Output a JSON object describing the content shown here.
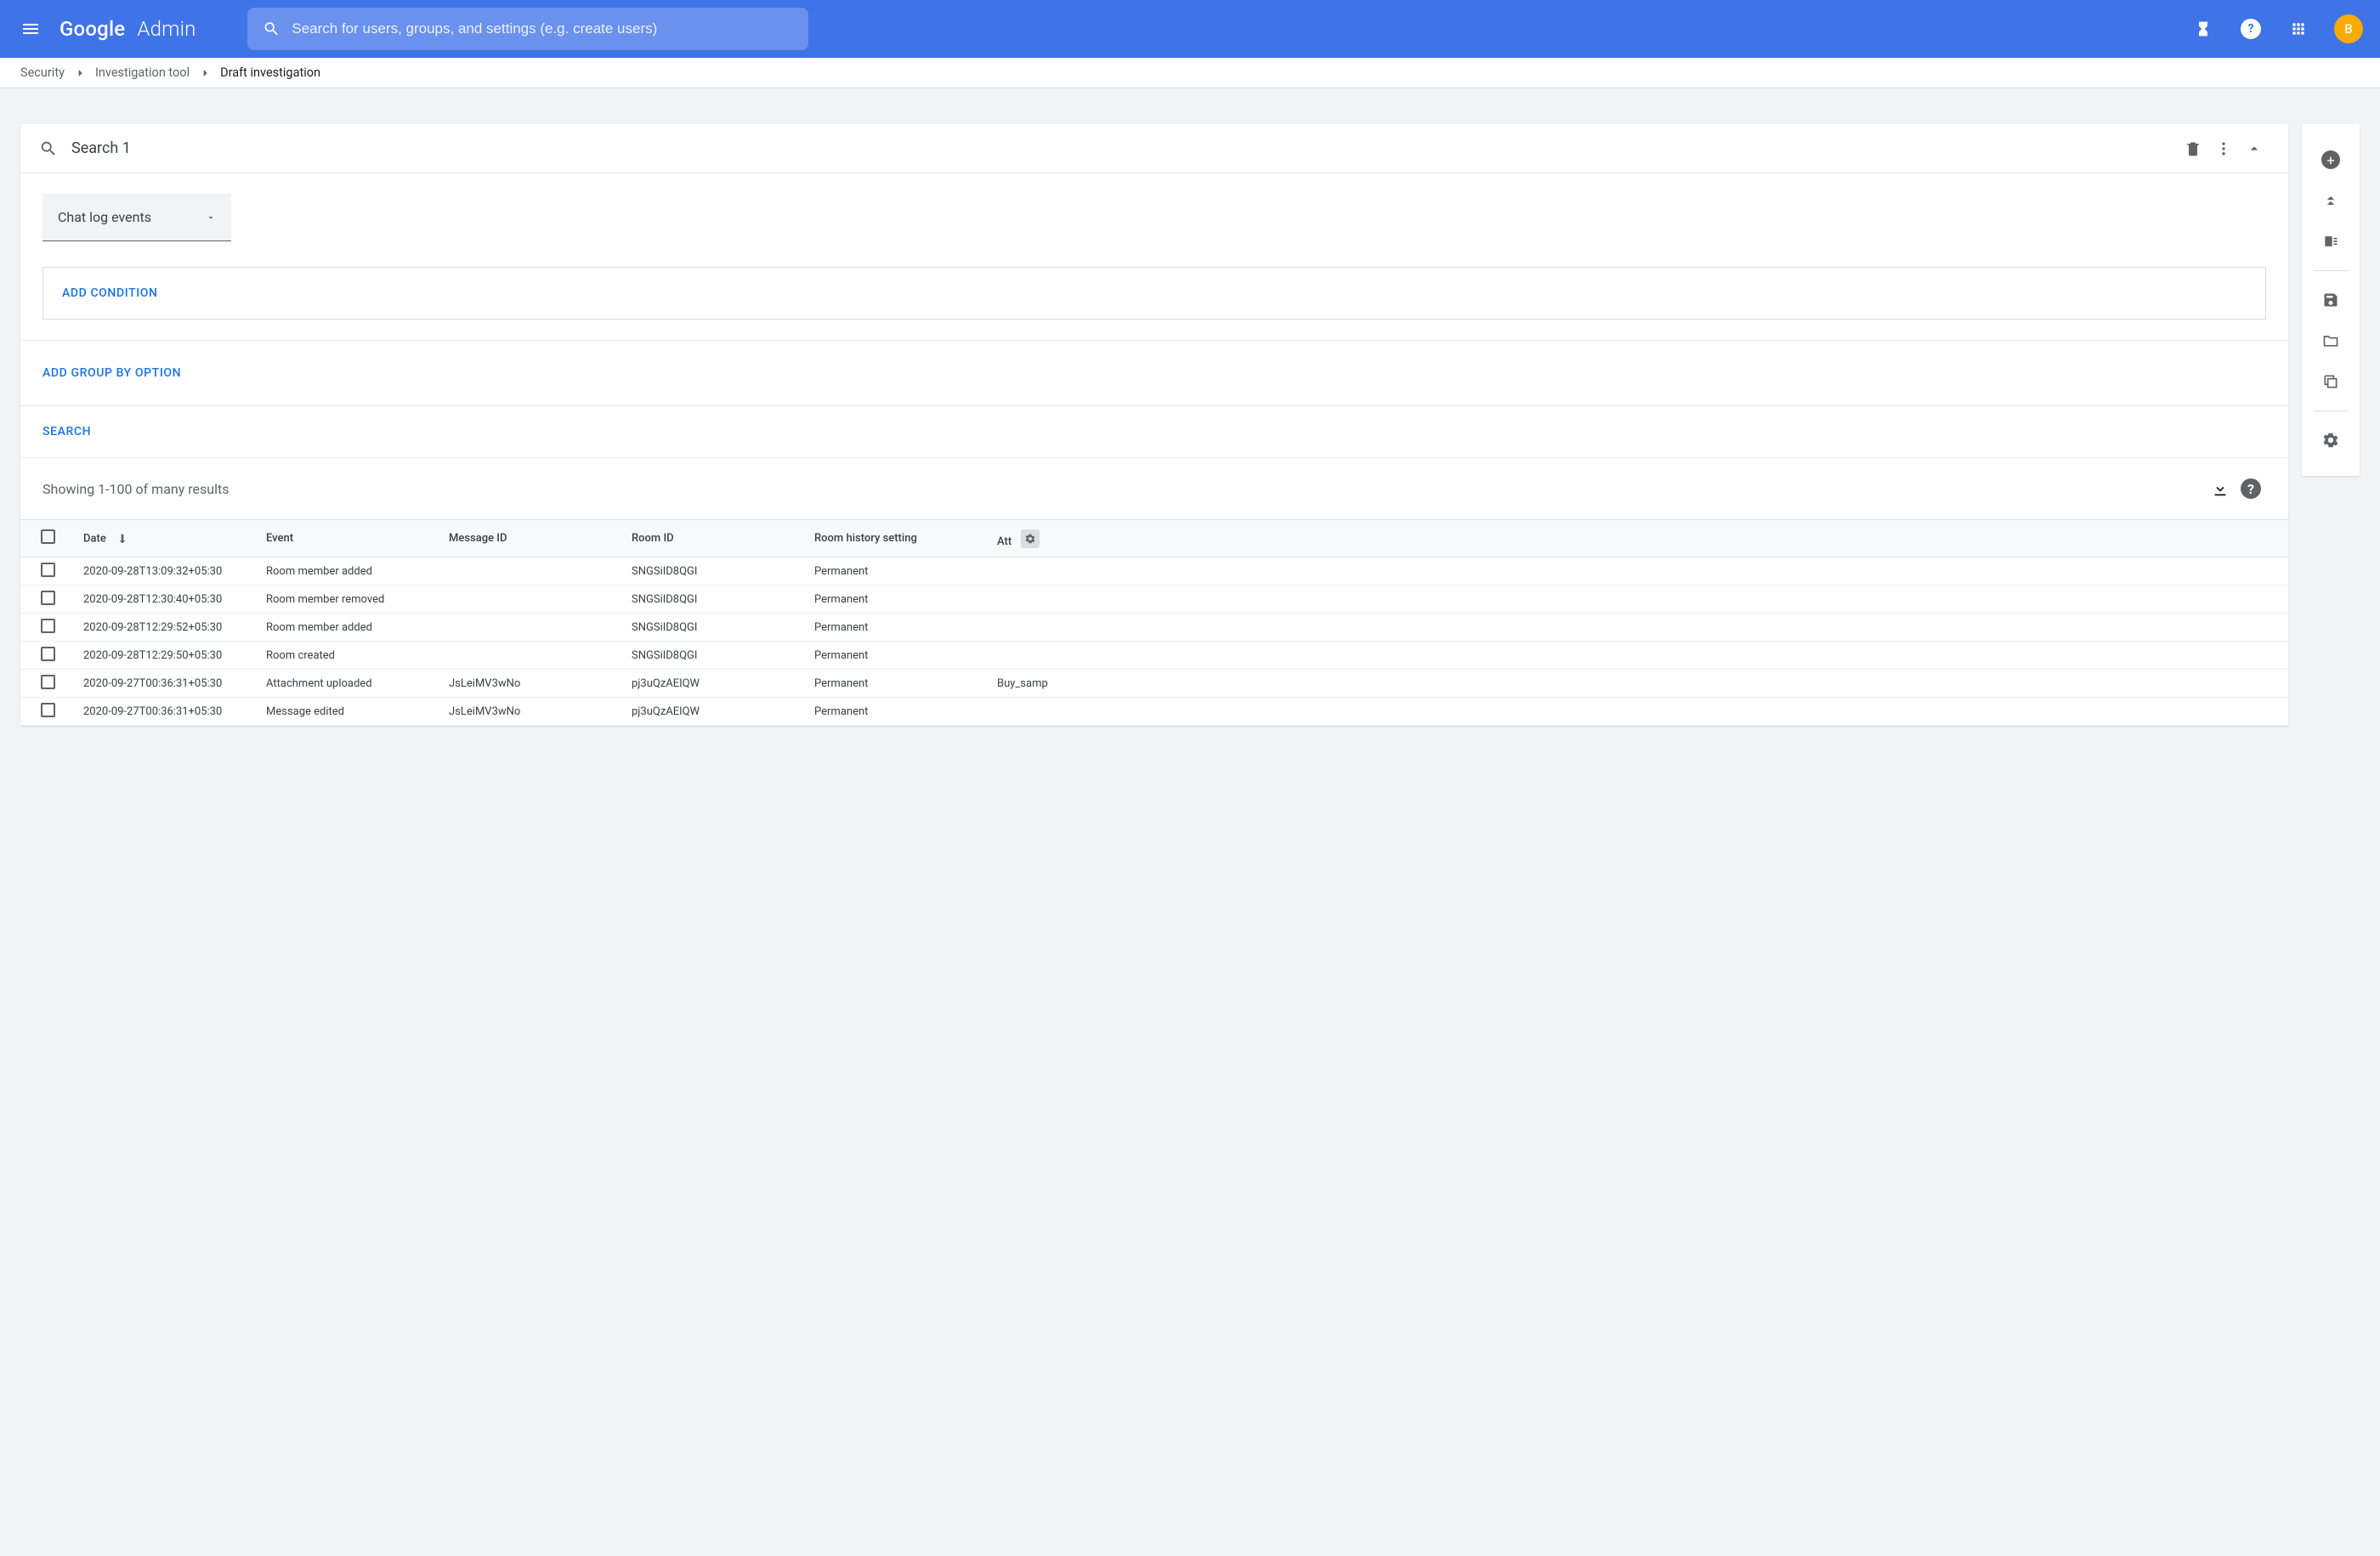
{
  "header": {
    "logo_text": "Google",
    "product": "Admin",
    "search_placeholder": "Search for users, groups, and settings (e.g. create users)",
    "avatar_initial": "B"
  },
  "breadcrumbs": {
    "items": [
      "Security",
      "Investigation tool",
      "Draft investigation"
    ]
  },
  "search_card": {
    "title": "Search 1",
    "data_source": "Chat log events",
    "add_condition": "ADD CONDITION",
    "add_group_by": "ADD GROUP BY OPTION",
    "search_action": "SEARCH"
  },
  "results": {
    "summary": "Showing 1-100 of many results",
    "columns": {
      "date": "Date",
      "event": "Event",
      "message_id": "Message ID",
      "room_id": "Room ID",
      "history": "Room history setting",
      "att": "Att"
    },
    "rows": [
      {
        "date": "2020-09-28T13:09:32+05:30",
        "event": "Room member added",
        "message_id": "",
        "room_id": "SNGSiID8QGI",
        "history": "Permanent",
        "att": ""
      },
      {
        "date": "2020-09-28T12:30:40+05:30",
        "event": "Room member removed",
        "message_id": "",
        "room_id": "SNGSiID8QGI",
        "history": "Permanent",
        "att": ""
      },
      {
        "date": "2020-09-28T12:29:52+05:30",
        "event": "Room member added",
        "message_id": "",
        "room_id": "SNGSiID8QGI",
        "history": "Permanent",
        "att": ""
      },
      {
        "date": "2020-09-28T12:29:50+05:30",
        "event": "Room created",
        "message_id": "",
        "room_id": "SNGSiID8QGI",
        "history": "Permanent",
        "att": ""
      },
      {
        "date": "2020-09-27T00:36:31+05:30",
        "event": "Attachment uploaded",
        "message_id": "JsLeiMV3wNo",
        "room_id": "pj3uQzAEIQW",
        "history": "Permanent",
        "att": "Buy_samp"
      },
      {
        "date": "2020-09-27T00:36:31+05:30",
        "event": "Message edited",
        "message_id": "JsLeiMV3wNo",
        "room_id": "pj3uQzAEIQW",
        "history": "Permanent",
        "att": ""
      }
    ]
  }
}
